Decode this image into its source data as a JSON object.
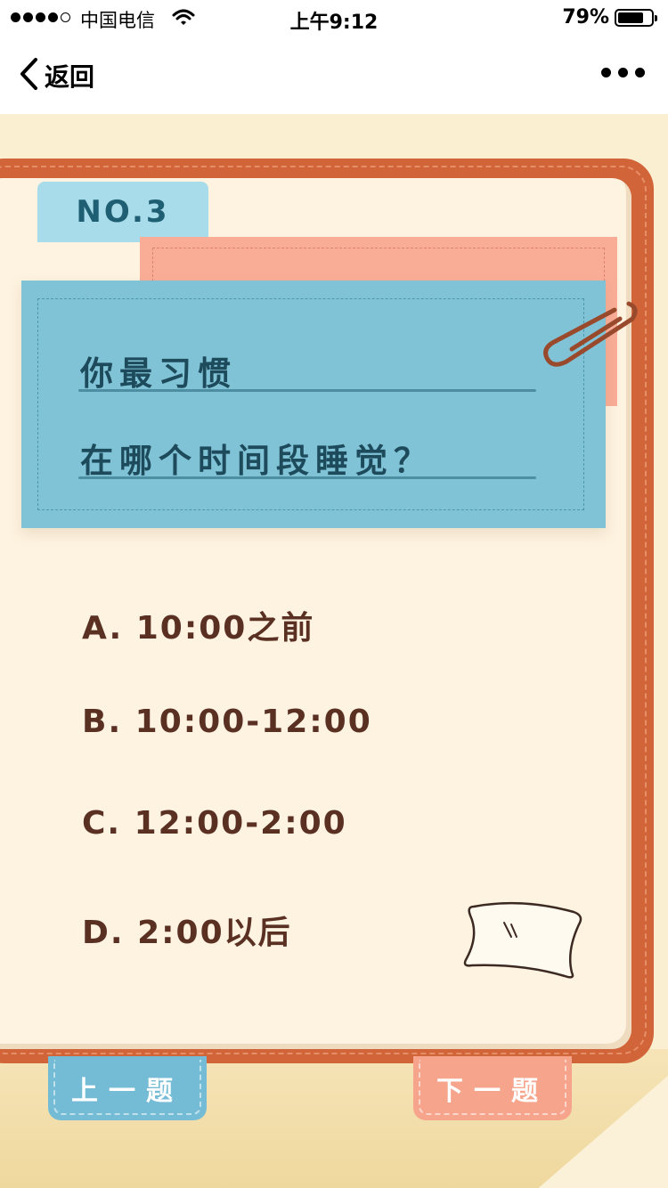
{
  "status_bar": {
    "carrier": "中国电信",
    "time": "上午9:12",
    "battery_percent_text": "79%",
    "battery_level": 0.79
  },
  "nav": {
    "back_label": "返回"
  },
  "quiz": {
    "number": "NO.3",
    "question_line1": "你最习惯",
    "question_line2": "在哪个时间段睡觉？",
    "options": [
      "A. 10:00之前",
      "B. 10:00-12:00",
      "C. 12:00-2:00",
      "D. 2:00以后"
    ],
    "prev_label": "上一题",
    "next_label": "下一题"
  },
  "colors": {
    "binder": "#d2643a",
    "paper": "#fdf3e0",
    "blue_card": "#80c3d6",
    "pink_card": "#f9ad97",
    "option_text": "#5a3023"
  }
}
